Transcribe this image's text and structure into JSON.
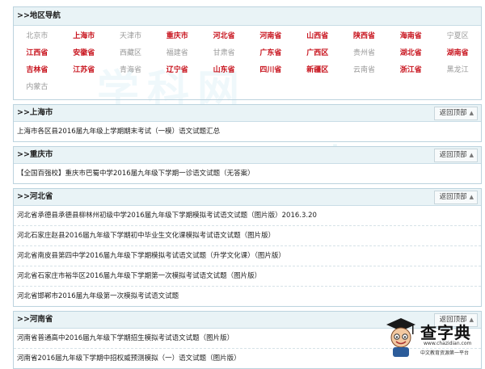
{
  "region_nav": {
    "title": ">>地区导航",
    "items": [
      {
        "label": "北京市",
        "active": false
      },
      {
        "label": "上海市",
        "active": true
      },
      {
        "label": "天津市",
        "active": false
      },
      {
        "label": "重庆市",
        "active": true
      },
      {
        "label": "河北省",
        "active": true
      },
      {
        "label": "河南省",
        "active": true
      },
      {
        "label": "山西省",
        "active": true
      },
      {
        "label": "陕西省",
        "active": true
      },
      {
        "label": "海南省",
        "active": true
      },
      {
        "label": "宁夏区",
        "active": false
      },
      {
        "label": "江西省",
        "active": true
      },
      {
        "label": "安徽省",
        "active": true
      },
      {
        "label": "西藏区",
        "active": false
      },
      {
        "label": "福建省",
        "active": false
      },
      {
        "label": "甘肃省",
        "active": false
      },
      {
        "label": "广东省",
        "active": true
      },
      {
        "label": "广西区",
        "active": true
      },
      {
        "label": "贵州省",
        "active": false
      },
      {
        "label": "湖北省",
        "active": true
      },
      {
        "label": "湖南省",
        "active": true
      },
      {
        "label": "吉林省",
        "active": true
      },
      {
        "label": "江苏省",
        "active": true
      },
      {
        "label": "青海省",
        "active": false
      },
      {
        "label": "辽宁省",
        "active": true
      },
      {
        "label": "山东省",
        "active": true
      },
      {
        "label": "四川省",
        "active": true
      },
      {
        "label": "新疆区",
        "active": true
      },
      {
        "label": "云南省",
        "active": false
      },
      {
        "label": "浙江省",
        "active": true
      },
      {
        "label": "黑龙江",
        "active": false
      },
      {
        "label": "内蒙古",
        "active": false
      }
    ]
  },
  "back_label": "返回顶部",
  "sections": [
    {
      "title": ">>上海市",
      "rows": [
        "上海市各区县2016届九年级上学期期末考试（一模）语文试题汇总"
      ]
    },
    {
      "title": ">>重庆市",
      "rows": [
        "【全国百强校】重庆市巴蜀中学2016届九年级下学期一诊语文试题（无答案）"
      ]
    },
    {
      "title": ">>河北省",
      "rows": [
        "河北省承德县承德县柳林州初级中学2016届九年级下学期模拟考试语文试题（图片版）2016.3.20",
        "河北石家庄赵县2016届九年级下学期初中毕业生文化课模拟考试语文试题（图片版）",
        "河北省南皮县第四中学2016届九年级下学期模拟考试语文试题（升学文化课）（图片版）",
        "河北省石家庄市裕华区2016届九年级下学期第一次模拟考试语文试题（图片版）",
        "河北省邯郸市2016届九年级第一次模拟考试语文试题"
      ]
    },
    {
      "title": ">>河南省",
      "rows": [
        "河南省普通高中2016届九年级下学期招生模拟考试语文试题（图片版）",
        "河南省2016届九年级下学期中招权威预测模拟（一）语文试题（图片版）"
      ]
    }
  ],
  "logo": {
    "brand": "查字典",
    "url": "www.chazidian.com",
    "slogan": "中文教育资源第一平台"
  },
  "colors": {
    "active": "#c8141e",
    "inactive": "#999999",
    "header_bg": "#e9f3f6",
    "border": "#bcd3de"
  }
}
